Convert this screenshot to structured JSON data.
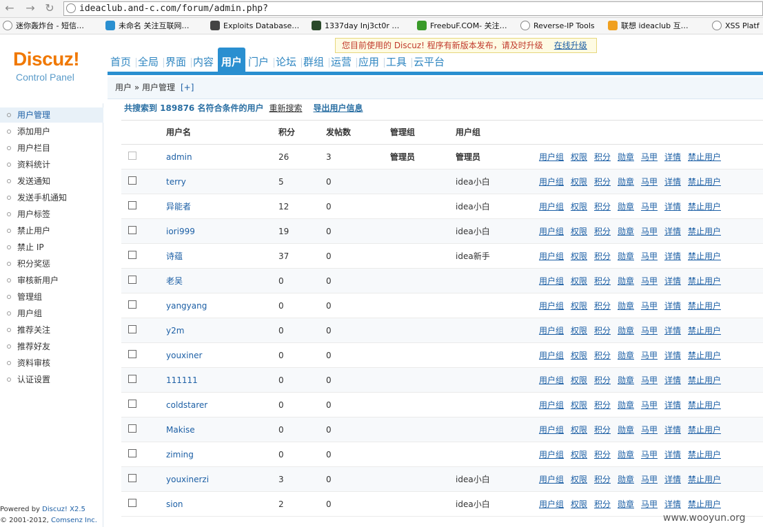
{
  "browser": {
    "url": "ideaclub.and-c.com/forum/admin.php?",
    "bookmarks": [
      {
        "label": "迷你轰炸台 - 短信…",
        "icon": "circle-globe-icon",
        "color": "#888888"
      },
      {
        "label": "未命名 关注互联网…",
        "icon": "mb-icon",
        "color": "#2a8fd0"
      },
      {
        "label": "Exploits Database…",
        "icon": "ghost-icon",
        "color": "#444444"
      },
      {
        "label": "1337day Inj3ct0r …",
        "icon": "square-icon",
        "color": "#2b4a2b"
      },
      {
        "label": "FreebuF.COM- 关注…",
        "icon": "f-icon",
        "color": "#3a9a2a"
      },
      {
        "label": "Reverse-IP Tools",
        "icon": "circle-globe-icon",
        "color": "#888888"
      },
      {
        "label": "联想 ideaclub 互…",
        "icon": "windows-icon",
        "color": "#f0a020"
      },
      {
        "label": "XSS Platf",
        "icon": "circle-globe-icon",
        "color": "#888888"
      }
    ]
  },
  "logo": {
    "line1": "Discuz!",
    "line2": "Control Panel"
  },
  "notice": {
    "text": "您目前使用的 Discuz! 程序有新版本发布，请及时升级",
    "link": "在线升级"
  },
  "topnav": [
    "首页",
    "全局",
    "界面",
    "内容",
    "用户",
    "门户",
    "论坛",
    "群组",
    "运营",
    "应用",
    "工具",
    "云平台"
  ],
  "breadcrumb": {
    "path": "用户 » 用户管理",
    "plus": "[+]"
  },
  "sidebar": {
    "items": [
      "用户管理",
      "添加用户",
      "用户栏目",
      "资料统计",
      "发送通知",
      "发送手机通知",
      "用户标签",
      "禁止用户",
      "禁止 IP",
      "积分奖惩",
      "审核新用户",
      "管理组",
      "用户组",
      "推荐关注",
      "推荐好友",
      "资料审核",
      "认证设置"
    ],
    "active": 0
  },
  "footer": {
    "powered": "Powered by ",
    "product": "Discuz! X2.5",
    "copyright": "© 2001-2012, ",
    "company": "Comsenz Inc."
  },
  "search": {
    "summary": "共搜索到 189876 名符合条件的用户",
    "research": "重新搜索",
    "export": "导出用户信息"
  },
  "table": {
    "headers": {
      "username": "用户名",
      "points": "积分",
      "posts": "发帖数",
      "admin_group": "管理组",
      "user_group": "用户组"
    },
    "op_labels": [
      "用户组",
      "权限",
      "积分",
      "勋章",
      "马甲",
      "详情",
      "禁止用户"
    ],
    "rows": [
      {
        "username": "admin",
        "points": "26",
        "posts": "3",
        "admin_group": "管理员",
        "user_group": "管理员",
        "bold_group": true
      },
      {
        "username": "terry",
        "points": "5",
        "posts": "0",
        "admin_group": "",
        "user_group": "idea小白"
      },
      {
        "username": "异能者",
        "points": "12",
        "posts": "0",
        "admin_group": "",
        "user_group": "idea小白"
      },
      {
        "username": "iori999",
        "points": "19",
        "posts": "0",
        "admin_group": "",
        "user_group": "idea小白"
      },
      {
        "username": "诗蕴",
        "points": "37",
        "posts": "0",
        "admin_group": "",
        "user_group": "idea新手"
      },
      {
        "username": "老吴",
        "points": "0",
        "posts": "0",
        "admin_group": "",
        "user_group": ""
      },
      {
        "username": "yangyang",
        "points": "0",
        "posts": "0",
        "admin_group": "",
        "user_group": ""
      },
      {
        "username": "y2m",
        "points": "0",
        "posts": "0",
        "admin_group": "",
        "user_group": ""
      },
      {
        "username": "youxiner",
        "points": "0",
        "posts": "0",
        "admin_group": "",
        "user_group": ""
      },
      {
        "username": "111111",
        "points": "0",
        "posts": "0",
        "admin_group": "",
        "user_group": ""
      },
      {
        "username": "coldstarer",
        "points": "0",
        "posts": "0",
        "admin_group": "",
        "user_group": ""
      },
      {
        "username": "Makise",
        "points": "0",
        "posts": "0",
        "admin_group": "",
        "user_group": ""
      },
      {
        "username": "ziming",
        "points": "0",
        "posts": "0",
        "admin_group": "",
        "user_group": ""
      },
      {
        "username": "youxinerzi",
        "points": "3",
        "posts": "0",
        "admin_group": "",
        "user_group": "idea小白"
      },
      {
        "username": "sion",
        "points": "2",
        "posts": "0",
        "admin_group": "",
        "user_group": "idea小白"
      }
    ]
  },
  "watermark": "www.wooyun.org"
}
